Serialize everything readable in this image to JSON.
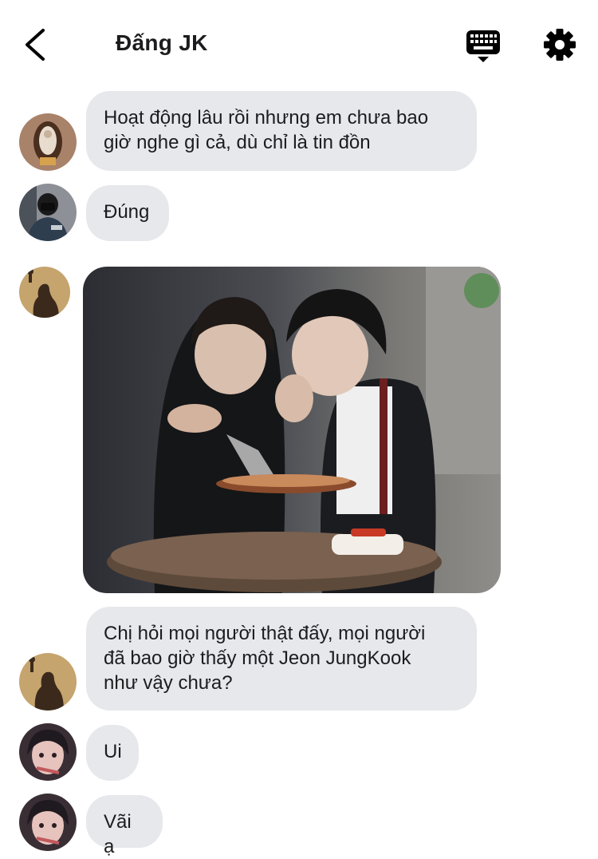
{
  "header": {
    "title": "Đấng JK",
    "back_icon": "chevron-left-icon",
    "keyboard_icon": "keyboard-icon",
    "settings_icon": "gear-icon"
  },
  "messages": [
    {
      "text": "Hoạt động lâu rồi nhưng em chưa bao\ngiờ nghe gì cả, dù chỉ là tin đồn"
    },
    {
      "text": "Đúng"
    },
    {
      "type": "image"
    },
    {
      "text": "Chị hỏi mọi người thật đấy, mọi người\nđã bao giờ thấy một Jeon JungKook\nnhư vậy chưa?"
    },
    {
      "text": "Ui"
    },
    {
      "text": "Vãi ạ"
    }
  ],
  "colors": {
    "bubble": "#e6e8ec",
    "text": "#1c1c1e",
    "icon": "#000000"
  }
}
